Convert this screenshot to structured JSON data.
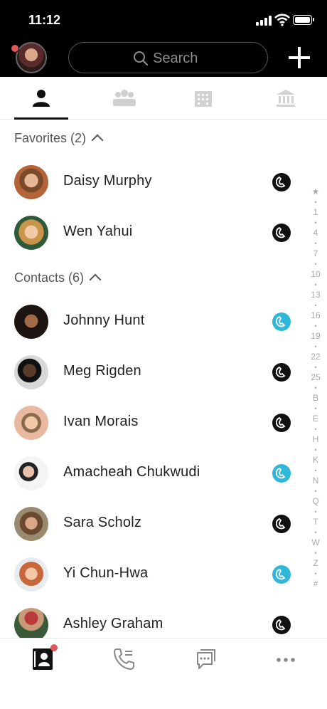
{
  "status": {
    "time": "11:12"
  },
  "search": {
    "placeholder": "Search"
  },
  "sections": {
    "favorites": "Favorites (2)",
    "contacts": "Contacts (6)"
  },
  "favorites": [
    {
      "name": "Daisy Murphy",
      "presence": "dark"
    },
    {
      "name": "Wen Yahui",
      "presence": "dark"
    }
  ],
  "contacts": [
    {
      "name": "Johnny Hunt",
      "presence": "blue"
    },
    {
      "name": "Meg Rigden",
      "presence": "dark"
    },
    {
      "name": "Ivan Morais",
      "presence": "dark"
    },
    {
      "name": "Amacheah Chukwudi",
      "presence": "blue"
    },
    {
      "name": "Sara Scholz",
      "presence": "dark"
    },
    {
      "name": "Yi Chun-Hwa",
      "presence": "blue"
    },
    {
      "name": "Ashley Graham",
      "presence": "dark"
    }
  ],
  "alphabet_index": [
    "★",
    "•",
    "1",
    "•",
    "4",
    "•",
    "7",
    "•",
    "10",
    "•",
    "13",
    "•",
    "16",
    "•",
    "19",
    "•",
    "22",
    "•",
    "25",
    "•",
    "B",
    "•",
    "E",
    "•",
    "H",
    "•",
    "K",
    "•",
    "N",
    "•",
    "Q",
    "•",
    "T",
    "•",
    "W",
    "•",
    "Z",
    "•",
    "#"
  ],
  "colors": {
    "accent_blue": "#2fb6d9",
    "badge_red": "#e0555a",
    "header": "#000000"
  },
  "icons": {
    "tabs": [
      "person-icon",
      "group-icon",
      "building-icon",
      "bank-icon"
    ],
    "nav": [
      "contacts-book-icon",
      "call-history-icon",
      "chat-icon",
      "more-icon"
    ]
  }
}
